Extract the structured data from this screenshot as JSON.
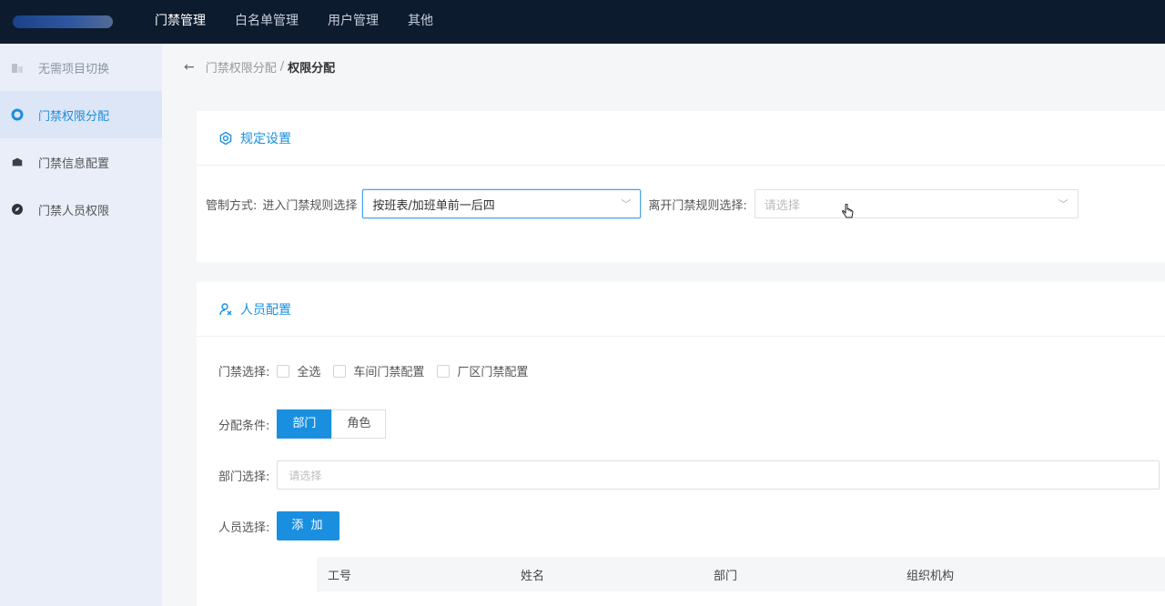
{
  "header": {
    "nav": [
      {
        "label": "门禁管理",
        "active": true
      },
      {
        "label": "白名单管理",
        "active": false
      },
      {
        "label": "用户管理",
        "active": false
      },
      {
        "label": "其他",
        "active": false
      }
    ]
  },
  "sidebar": {
    "items": [
      {
        "label": "无需项目切换",
        "icon": "building-icon"
      },
      {
        "label": "门禁权限分配",
        "icon": "circle-icon",
        "active": true
      },
      {
        "label": "门禁信息配置",
        "icon": "box-icon"
      },
      {
        "label": "门禁人员权限",
        "icon": "compass-icon"
      }
    ]
  },
  "breadcrumb": {
    "back": "←",
    "parent": "门禁权限分配",
    "separator": "/",
    "current": "权限分配"
  },
  "rules": {
    "title": "规定设置",
    "mode_label": "管制方式:",
    "enter_label": "进入门禁规则选择",
    "enter_value": "按班表/加班单前一后四",
    "leave_label": "离开门禁规则选择:",
    "leave_placeholder": "请选择"
  },
  "personnel": {
    "title": "人员配置",
    "door_label": "门禁选择:",
    "door_options": [
      "全选",
      "车间门禁配置",
      "厂区门禁配置"
    ],
    "condition_label": "分配条件:",
    "condition_options": [
      "部门",
      "角色"
    ],
    "dept_label": "部门选择:",
    "dept_placeholder": "请选择",
    "person_label": "人员选择:",
    "add_button": "添 加",
    "table_headers": [
      "工号",
      "姓名",
      "部门",
      "组织机构"
    ]
  },
  "colors": {
    "topbar": "#0d1b2e",
    "accent": "#1a8fe0",
    "sidebar": "#e9eef8"
  }
}
